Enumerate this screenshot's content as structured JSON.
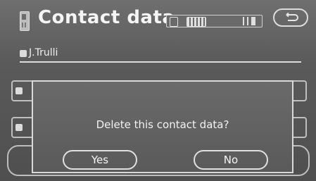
{
  "header": {
    "title": "Contact data",
    "status_icons": [
      "bluetooth-icon",
      "battery-icon",
      "signal-icon"
    ],
    "back_icon": "return-arrow-icon"
  },
  "contact": {
    "name": "J.Trulli",
    "icon": "person-icon"
  },
  "dialog": {
    "message": "Delete this contact data?",
    "yes_label": "Yes",
    "no_label": "No"
  },
  "colors": {
    "background": "#5a5a5a",
    "border": "#d9d9d9",
    "text": "#f2f2f2"
  }
}
